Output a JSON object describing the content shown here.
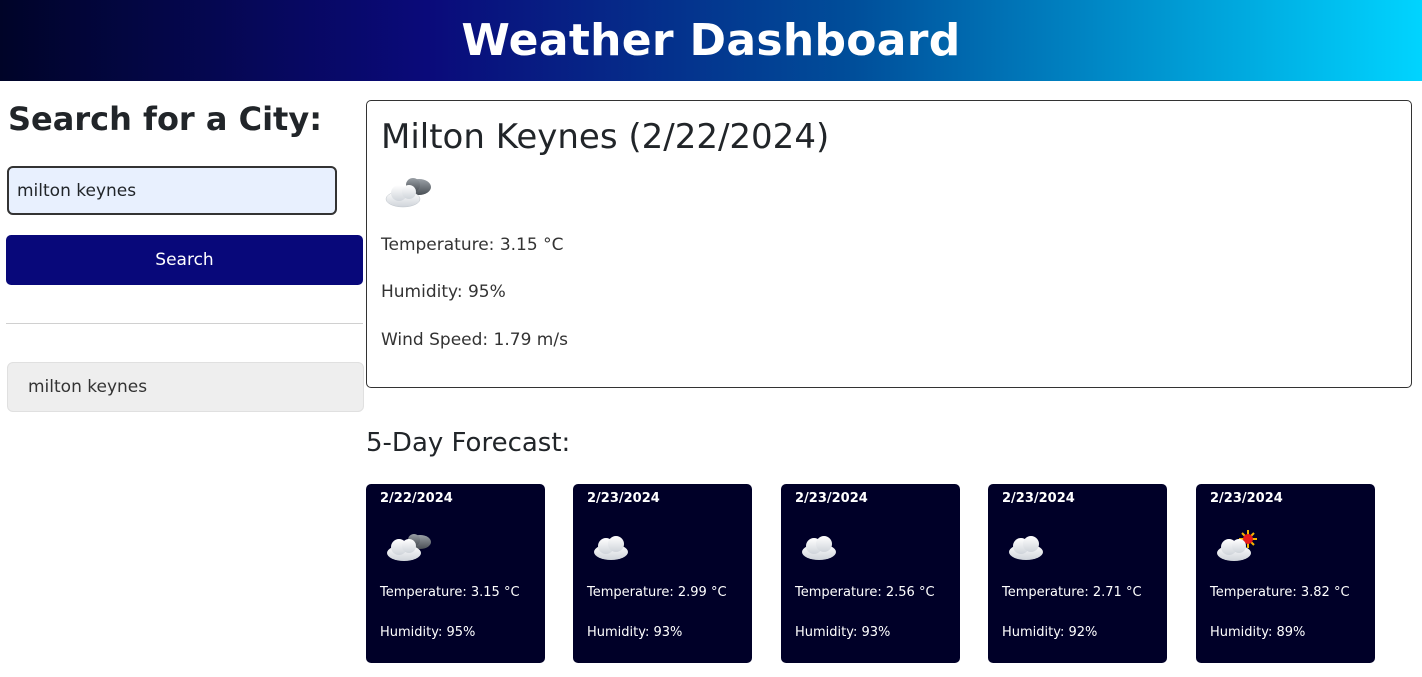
{
  "header": {
    "title": "Weather Dashboard"
  },
  "sidebar": {
    "heading": "Search for a City:",
    "search_value": "milton keynes",
    "search_button": "Search",
    "history": [
      "milton keynes"
    ]
  },
  "current": {
    "title": "Milton Keynes (2/22/2024)",
    "icon": "cloud-moon-icon",
    "temperature": "Temperature: 3.15 °C",
    "humidity": "Humidity: 95%",
    "wind": "Wind Speed: 1.79 m/s"
  },
  "forecast": {
    "title": "5-Day Forecast:",
    "days": [
      {
        "date": "2/22/2024",
        "icon": "cloud-moon-icon",
        "temperature": "Temperature: 3.15 °C",
        "humidity": "Humidity: 95%"
      },
      {
        "date": "2/23/2024",
        "icon": "cloud-icon",
        "temperature": "Temperature: 2.99 °C",
        "humidity": "Humidity: 93%"
      },
      {
        "date": "2/23/2024",
        "icon": "cloud-icon",
        "temperature": "Temperature: 2.56 °C",
        "humidity": "Humidity: 93%"
      },
      {
        "date": "2/23/2024",
        "icon": "cloud-icon",
        "temperature": "Temperature: 2.71 °C",
        "humidity": "Humidity: 92%"
      },
      {
        "date": "2/23/2024",
        "icon": "cloud-sun-icon",
        "temperature": "Temperature: 3.82 °C",
        "humidity": "Humidity: 89%"
      }
    ]
  },
  "colors": {
    "header_gradient": [
      "#000428",
      "#0a0a7a",
      "#004e9a",
      "#00d4ff"
    ],
    "search_button": "#08087a",
    "card_background": "#000028"
  }
}
